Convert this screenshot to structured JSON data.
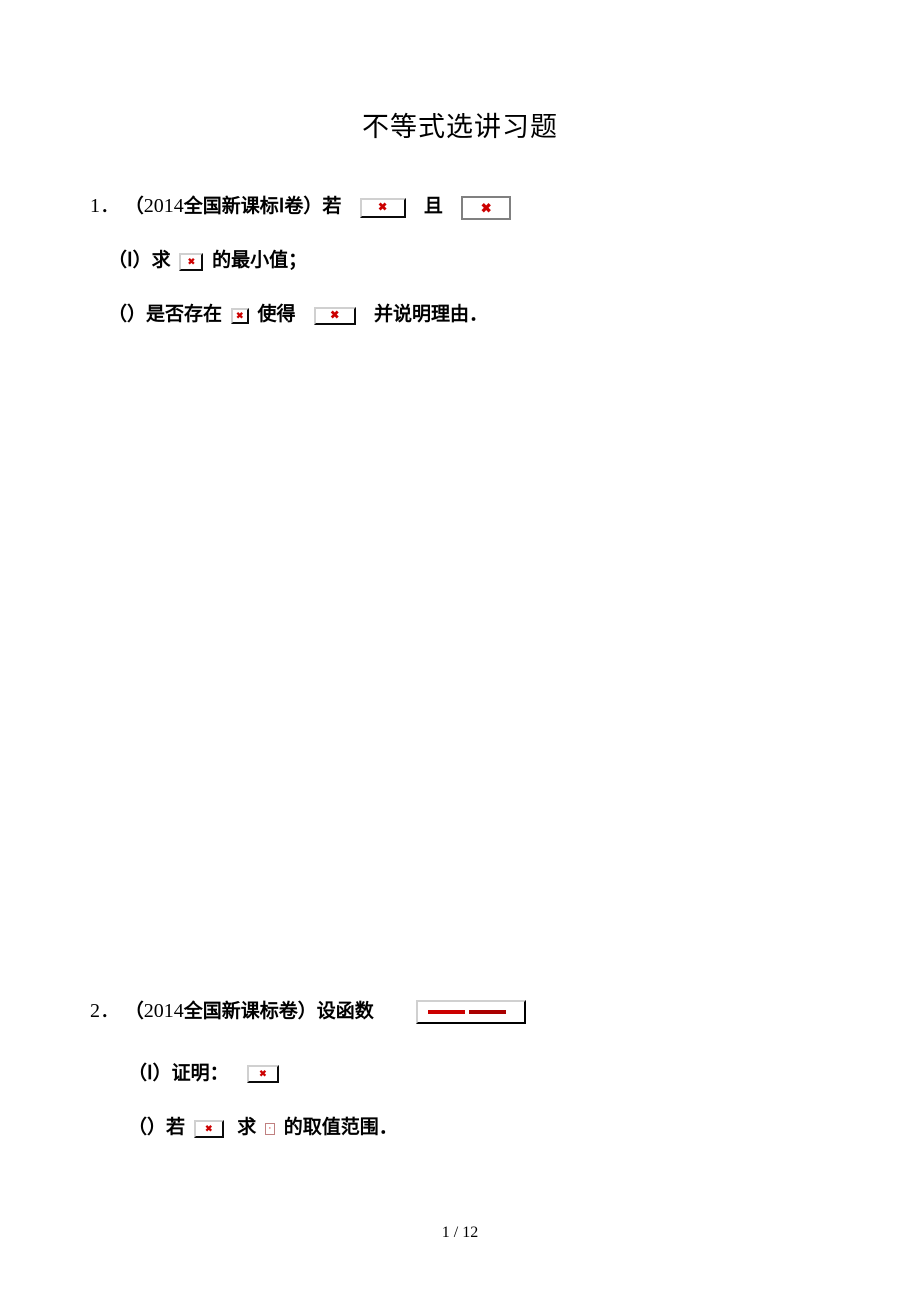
{
  "title": "不等式选讲习题",
  "q1": {
    "num": "1．",
    "source_open": "（",
    "year": "2014",
    "source_rest": "全国新课标Ⅰ卷）若",
    "and": "且",
    "part1_open": "（Ⅰ）求",
    "part1_rest": "的最小值；",
    "part2_open": "（）是否存在",
    "part2_mid": "使得",
    "part2_rest": "并说明理由．"
  },
  "q2": {
    "num": "2．",
    "source_open": "（",
    "year": "2014",
    "source_rest": "全国新课标卷）设函数",
    "part1_open": "（Ⅰ）证明：",
    "part2_open": "（）若",
    "part2_mid": "求",
    "part2_rest": "的取值范围．"
  },
  "footer": {
    "page": "1",
    "sep": " / ",
    "total": "12"
  }
}
